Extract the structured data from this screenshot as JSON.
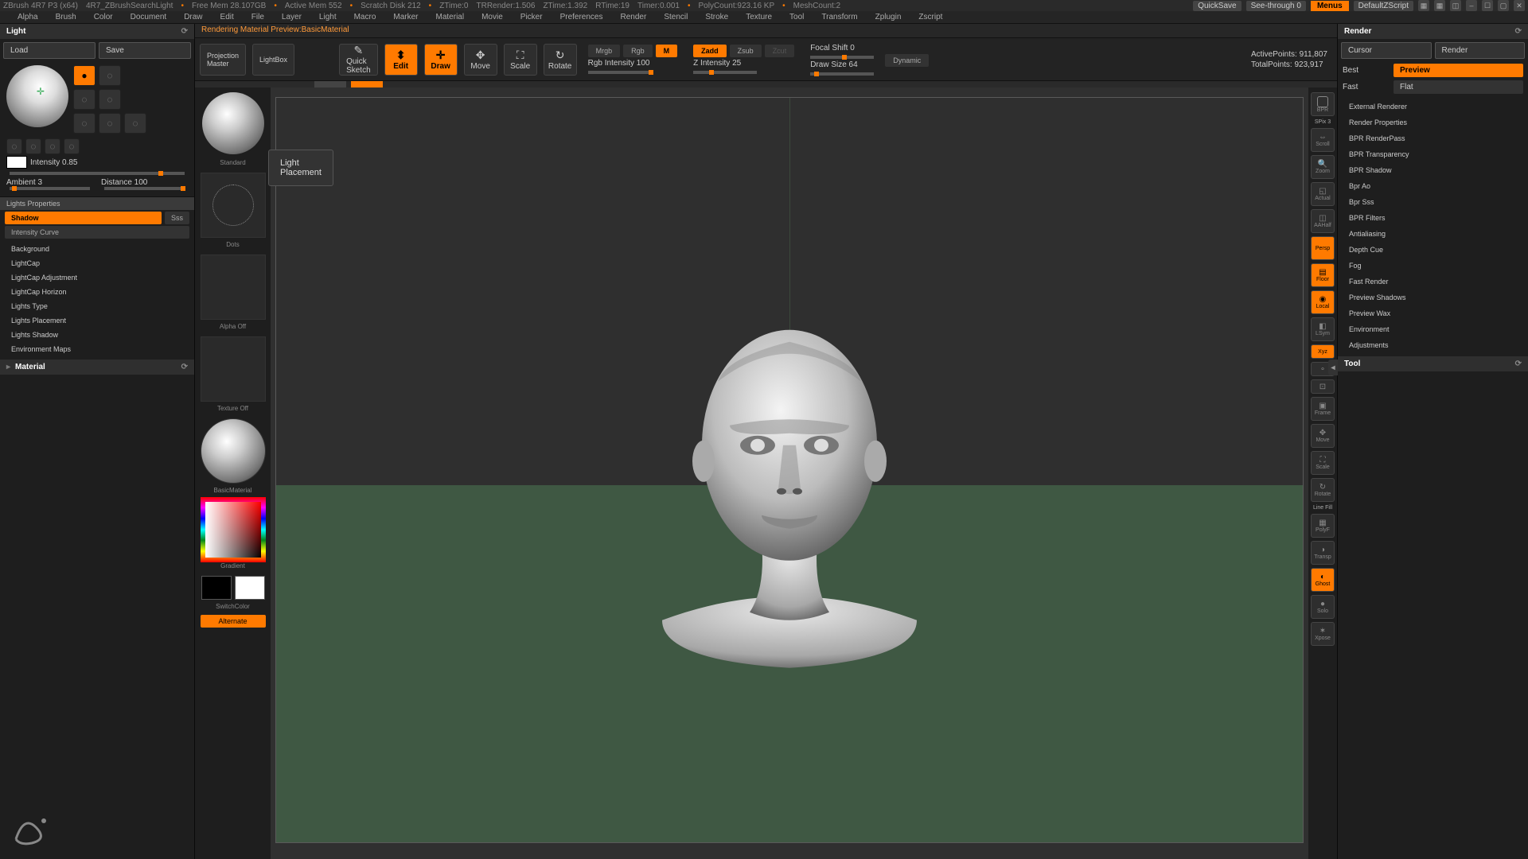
{
  "topbar": {
    "app": "ZBrush 4R7 P3 (x64)",
    "project": "4R7_ZBrushSearchLight",
    "stats": [
      "Free Mem 28.107GB",
      "Active Mem 552",
      "Scratch Disk 212",
      "ZTime:0",
      "TRRender:1.506",
      "ZTime:1.392",
      "RTime:19",
      "Timer:0.001",
      "PolyCount:923.16 KP",
      "MeshCount:2"
    ],
    "sep": "•",
    "quicksave": "QuickSave",
    "seethrough": "See-through    0",
    "menus": "Menus",
    "default": "DefaultZScript"
  },
  "menubar": [
    "Alpha",
    "Brush",
    "Color",
    "Document",
    "Draw",
    "Edit",
    "File",
    "Layer",
    "Light",
    "Macro",
    "Marker",
    "Material",
    "Movie",
    "Picker",
    "Preferences",
    "Render",
    "Stencil",
    "Stroke",
    "Texture",
    "Tool",
    "Transform",
    "Zplugin",
    "Zscript"
  ],
  "statusLine": "Rendering Material Preview:BasicMaterial",
  "leftPanel": {
    "title": "Light",
    "load": "Load",
    "save": "Save",
    "intensity_label": "Intensity 0.85",
    "ambient": "Ambient 3",
    "distance": "Distance 100",
    "lights_props": "Lights Properties",
    "shadow": "Shadow",
    "sss": "Sss",
    "intcurve": "Intensity Curve",
    "subs": [
      "Background",
      "LightCap",
      "LightCap Adjustment",
      "LightCap Horizon",
      "Lights Type",
      "Lights Placement",
      "Lights Shadow",
      "Environment Maps"
    ],
    "material": "Material"
  },
  "tooltip": "Light Placement",
  "shelf": {
    "projection": "Projection\nMaster",
    "lightbox": "LightBox",
    "quicksketch": "Quick\nSketch",
    "modeBtns": [
      "Edit",
      "Draw",
      "Move",
      "Scale",
      "Rotate"
    ],
    "mrgb": "Mrgb",
    "rgb": "Rgb",
    "m": "M",
    "rgb_int": "Rgb Intensity 100",
    "zadd": "Zadd",
    "zsub": "Zsub",
    "zcut": "Zcut",
    "z_int": "Z Intensity 25",
    "focal": "Focal Shift 0",
    "draw": "Draw Size 64",
    "dynamic": "Dynamic",
    "active": "ActivePoints: 911,807",
    "total": "TotalPoints: 923,917"
  },
  "matCol": {
    "standard": "Standard",
    "dots": "Dots",
    "alphaoff": "Alpha Off",
    "texoff": "Texture Off",
    "basicmat": "BasicMaterial",
    "gradient": "Gradient",
    "switch": "SwitchColor",
    "alternate": "Alternate"
  },
  "rightTools": [
    "BPR",
    "SPix 3",
    "Scroll",
    "Zoom",
    "Actual",
    "AAHalf",
    "Persp",
    "Floor",
    "Local",
    "LSym",
    "Xyz",
    "",
    "",
    "Frame",
    "Move",
    "Scale",
    "Rotate",
    "Line Fill",
    "PolyF",
    "Transp",
    "",
    "Ghost",
    "Solo",
    "Xpose"
  ],
  "rightPanel": {
    "title": "Render",
    "cursor": "Cursor",
    "render": "Render",
    "best": "Best",
    "preview": "Preview",
    "fast": "Fast",
    "flat": "Flat",
    "list": [
      "External Renderer",
      "Render Properties",
      "BPR RenderPass",
      "BPR Transparency",
      "BPR Shadow",
      "Bpr Ao",
      "Bpr Sss",
      "BPR Filters",
      "Antialiasing",
      "Depth Cue",
      "Fog",
      "Fast Render",
      "Preview Shadows",
      "Preview Wax",
      "Environment",
      "Adjustments"
    ],
    "tool": "Tool"
  }
}
